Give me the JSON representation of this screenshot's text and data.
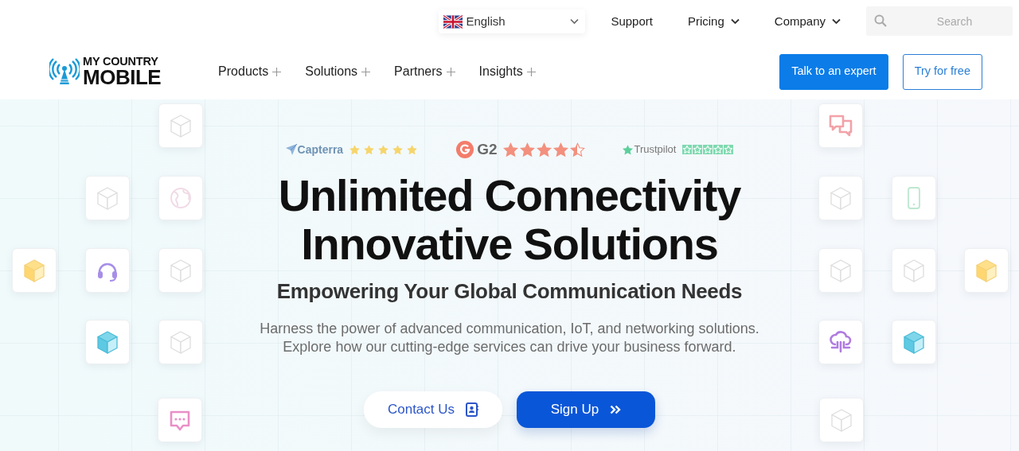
{
  "header": {
    "language": {
      "label": "English"
    },
    "top_links": [
      {
        "label": "Support",
        "dropdown": false
      },
      {
        "label": "Pricing",
        "dropdown": true
      },
      {
        "label": "Company",
        "dropdown": true
      }
    ],
    "search": {
      "placeholder": "Search"
    },
    "logo": {
      "line_1": "MY COUNTRY",
      "line_2": "MOBILE"
    },
    "nav": [
      {
        "label": "Products"
      },
      {
        "label": "Solutions"
      },
      {
        "label": "Partners"
      },
      {
        "label": "Insights"
      }
    ],
    "buttons": [
      {
        "label": "Talk to an expert",
        "kind": "primary"
      },
      {
        "label": "Try for free",
        "kind": "outline"
      }
    ]
  },
  "hero": {
    "ratings": [
      {
        "kind": "capterra",
        "site": "Capterra",
        "stars": 5
      },
      {
        "kind": "g2",
        "site": "G2",
        "stars": 4.5
      },
      {
        "kind": "trustpilot",
        "site": "Trustpilot",
        "stars": 5
      }
    ],
    "headline_lines": [
      "Unlimited Connectivity",
      "Innovative Solutions"
    ],
    "subheadline": "Empowering Your Global Communication Needs",
    "description": "Harness the power of advanced communication, IoT, and networking solutions.\nExplore how our cutting-edge services can drive your business forward.",
    "buttons": [
      {
        "label": "Contact Us",
        "kind": "light"
      },
      {
        "label": "Sign Up",
        "kind": "primary"
      }
    ]
  }
}
